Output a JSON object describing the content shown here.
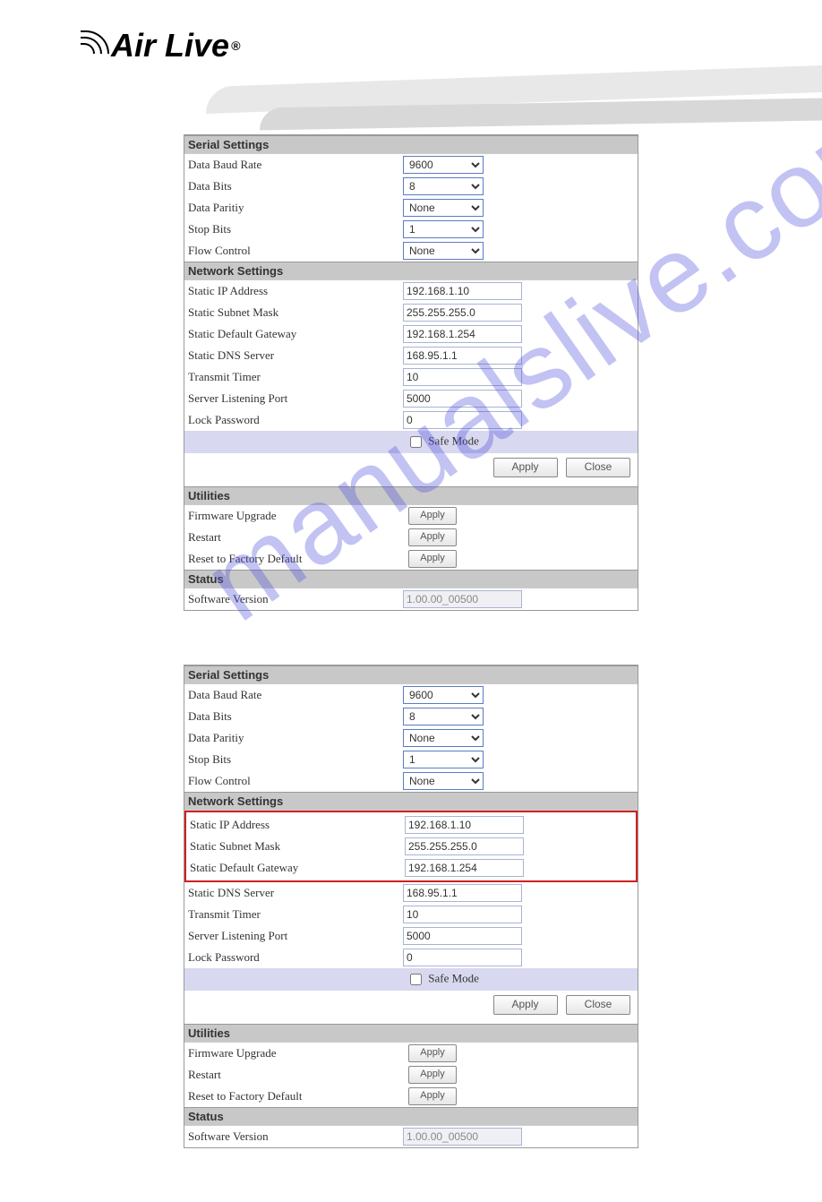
{
  "brand": "Air Live",
  "watermark": "manualslive.com",
  "buttons": {
    "apply": "Apply",
    "close": "Close"
  },
  "safemode_label": "Safe Mode",
  "panels": [
    {
      "highlight_network": false,
      "serial": {
        "header": "Serial Settings",
        "baud_label": "Data Baud Rate",
        "baud_value": "9600",
        "bits_label": "Data Bits",
        "bits_value": "8",
        "parity_label": "Data Paritiy",
        "parity_value": "None",
        "stop_label": "Stop Bits",
        "stop_value": "1",
        "flow_label": "Flow Control",
        "flow_value": "None"
      },
      "network": {
        "header": "Network Settings",
        "ip_label": "Static IP Address",
        "ip_value": "192.168.1.10",
        "mask_label": "Static Subnet Mask",
        "mask_value": "255.255.255.0",
        "gw_label": "Static Default Gateway",
        "gw_value": "192.168.1.254",
        "dns_label": "Static DNS Server",
        "dns_value": "168.95.1.1",
        "timer_label": "Transmit Timer",
        "timer_value": "10",
        "port_label": "Server Listening Port",
        "port_value": "5000",
        "pwd_label": "Lock Password",
        "pwd_value": "0"
      },
      "utilities": {
        "header": "Utilities",
        "fw_label": "Firmware Upgrade",
        "restart_label": "Restart",
        "reset_label": "Reset to Factory Default"
      },
      "status": {
        "header": "Status",
        "ver_label": "Software Version",
        "ver_value": "1.00.00_00500"
      }
    },
    {
      "highlight_network": true,
      "serial": {
        "header": "Serial Settings",
        "baud_label": "Data Baud Rate",
        "baud_value": "9600",
        "bits_label": "Data Bits",
        "bits_value": "8",
        "parity_label": "Data Paritiy",
        "parity_value": "None",
        "stop_label": "Stop Bits",
        "stop_value": "1",
        "flow_label": "Flow Control",
        "flow_value": "None"
      },
      "network": {
        "header": "Network Settings",
        "ip_label": "Static IP Address",
        "ip_value": "192.168.1.10",
        "mask_label": "Static Subnet Mask",
        "mask_value": "255.255.255.0",
        "gw_label": "Static Default Gateway",
        "gw_value": "192.168.1.254",
        "dns_label": "Static DNS Server",
        "dns_value": "168.95.1.1",
        "timer_label": "Transmit Timer",
        "timer_value": "10",
        "port_label": "Server Listening Port",
        "port_value": "5000",
        "pwd_label": "Lock Password",
        "pwd_value": "0"
      },
      "utilities": {
        "header": "Utilities",
        "fw_label": "Firmware Upgrade",
        "restart_label": "Restart",
        "reset_label": "Reset to Factory Default"
      },
      "status": {
        "header": "Status",
        "ver_label": "Software Version",
        "ver_value": "1.00.00_00500"
      }
    }
  ]
}
